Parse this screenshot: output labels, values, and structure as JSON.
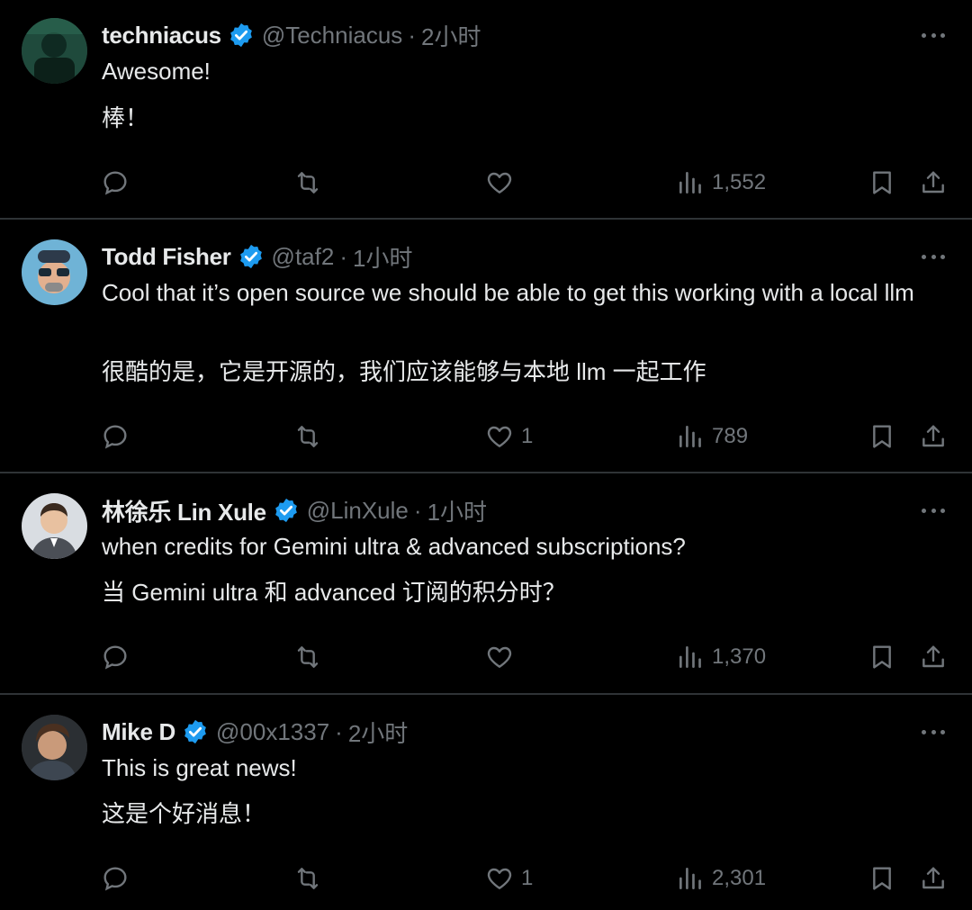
{
  "tweets": [
    {
      "name": "techniacus",
      "handle": "@Techniacus",
      "dot": "·",
      "time": "2小时",
      "lines": [
        "Awesome!",
        "棒！"
      ],
      "reply_count": "",
      "retweet_count": "",
      "like_count": "",
      "views": "1,552"
    },
    {
      "name": "Todd Fisher",
      "handle": "@taf2",
      "dot": "·",
      "time": "1小时",
      "lines": [
        "Cool that it’s open source we should be able to get this working with a local llm",
        "很酷的是，它是开源的，我们应该能够与本地 llm 一起工作"
      ],
      "reply_count": "",
      "retweet_count": "",
      "like_count": "1",
      "views": "789"
    },
    {
      "name": "林徐乐 Lin Xule",
      "handle": "@LinXule",
      "dot": "·",
      "time": "1小时",
      "lines": [
        "when credits for Gemini ultra & advanced subscriptions?",
        "当 Gemini ultra 和 advanced 订阅的积分时？"
      ],
      "reply_count": "",
      "retweet_count": "",
      "like_count": "",
      "views": "1,370"
    },
    {
      "name": "Mike D",
      "handle": "@00x1337",
      "dot": "·",
      "time": "2小时",
      "lines": [
        "This is great news!",
        "这是个好消息！"
      ],
      "reply_count": "",
      "retweet_count": "",
      "like_count": "1",
      "views": "2,301"
    }
  ],
  "icons": {
    "reply": "reply-icon",
    "retweet": "retweet-icon",
    "like": "heart-icon",
    "views": "views-chart-icon",
    "bookmark": "bookmark-icon",
    "share": "share-icon",
    "verified": "verified-badge-icon",
    "more": "more-options-icon"
  },
  "colors": {
    "background": "#000000",
    "text": "#e7e9ea",
    "secondary": "#71767b",
    "verified": "#1d9bf0",
    "divider": "#2f3336"
  }
}
